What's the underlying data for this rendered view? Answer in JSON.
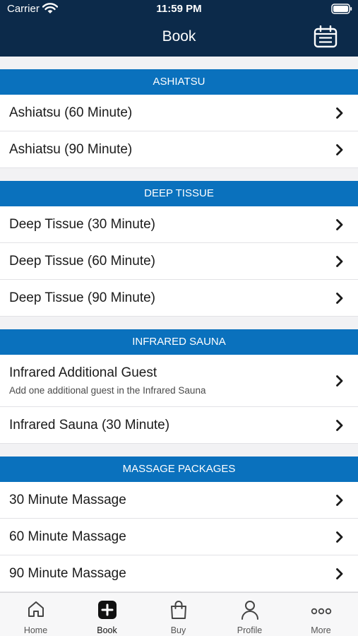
{
  "status_bar": {
    "carrier": "Carrier",
    "time": "11:59 PM"
  },
  "header": {
    "title": "Book",
    "action_icon": "calendar-icon"
  },
  "sections": [
    {
      "title": "ASHIATSU",
      "items": [
        {
          "title": "Ashiatsu (60 Minute)"
        },
        {
          "title": "Ashiatsu (90 Minute)"
        }
      ]
    },
    {
      "title": "DEEP TISSUE",
      "items": [
        {
          "title": "Deep Tissue (30 Minute)"
        },
        {
          "title": "Deep Tissue (60 Minute)"
        },
        {
          "title": "Deep Tissue (90 Minute)"
        }
      ]
    },
    {
      "title": "INFRARED SAUNA",
      "items": [
        {
          "title": "Infrared Additional Guest",
          "subtitle": "Add one additional guest in the Infrared Sauna"
        },
        {
          "title": "Infrared Sauna (30 Minute)"
        }
      ]
    },
    {
      "title": "MASSAGE PACKAGES",
      "items": [
        {
          "title": "30 Minute Massage"
        },
        {
          "title": "60 Minute Massage"
        },
        {
          "title": "90 Minute Massage"
        }
      ]
    }
  ],
  "tabbar": {
    "active": "Book",
    "tabs": [
      {
        "label": "Home",
        "icon": "home-icon"
      },
      {
        "label": "Book",
        "icon": "plus-square-icon"
      },
      {
        "label": "Buy",
        "icon": "shopping-bag-icon"
      },
      {
        "label": "Profile",
        "icon": "user-icon"
      },
      {
        "label": "More",
        "icon": "more-dots-icon"
      }
    ]
  },
  "colors": {
    "header_bg": "#0c2a4a",
    "section_bg": "#0a71bd",
    "page_bg": "#f2f2f4"
  }
}
